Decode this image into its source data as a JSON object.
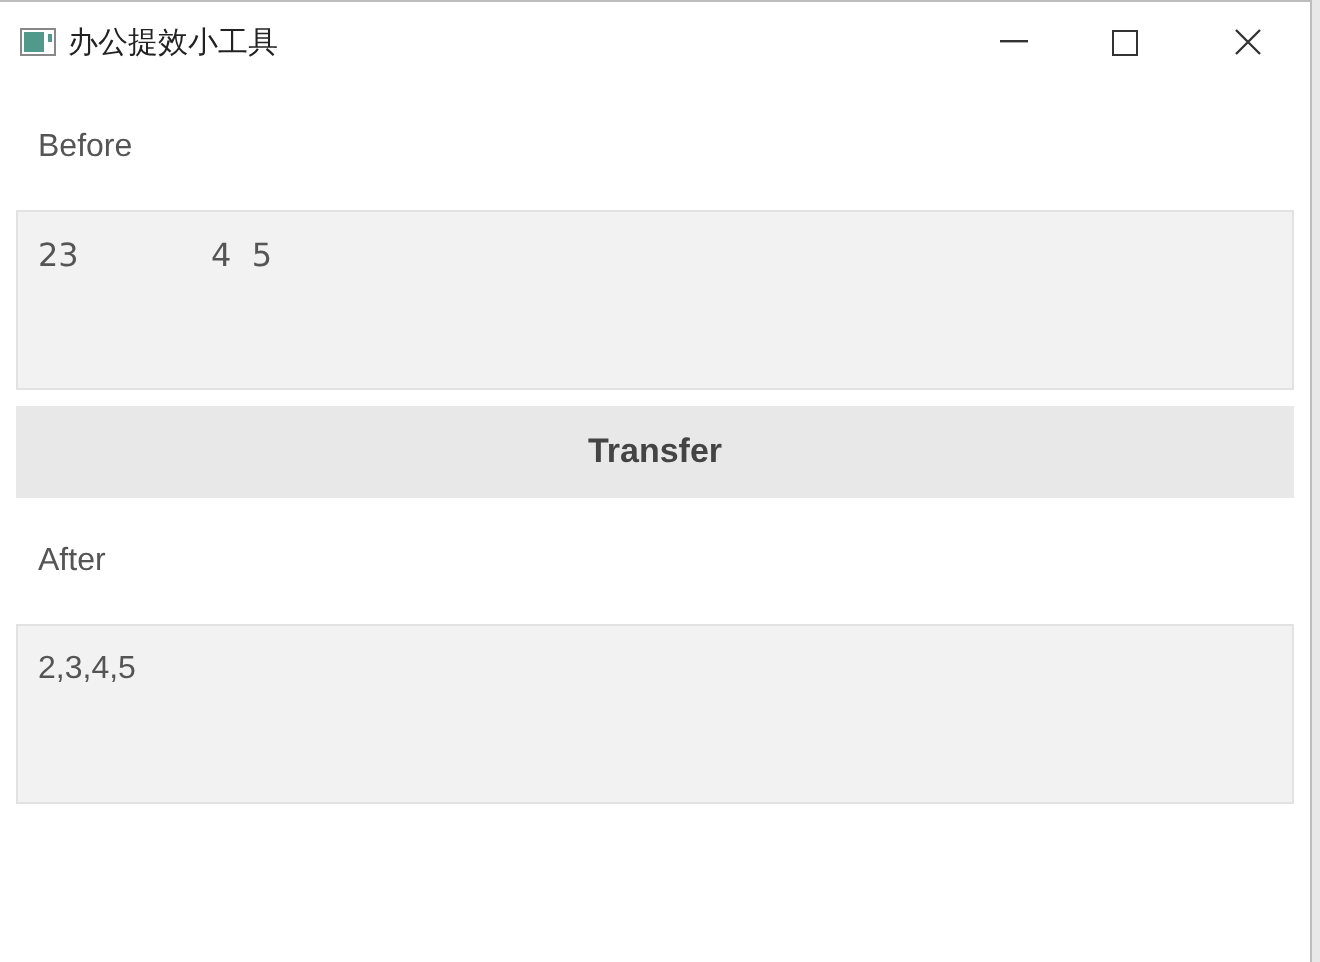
{
  "window": {
    "title": "办公提效小工具"
  },
  "before": {
    "label": "Before",
    "value": "23             4  5"
  },
  "button": {
    "label": "Transfer"
  },
  "after": {
    "label": "After",
    "value": "2,3,4,5"
  }
}
